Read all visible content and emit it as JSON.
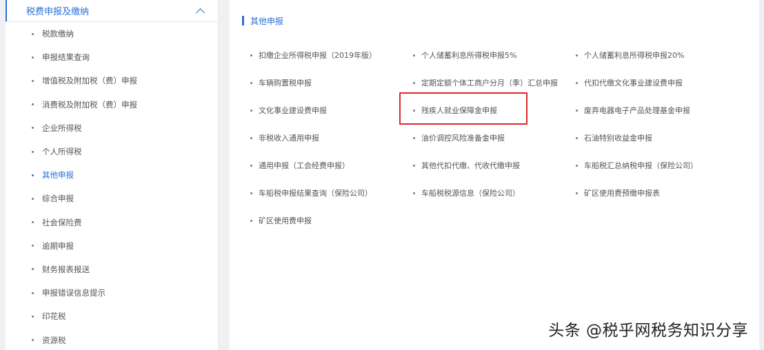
{
  "sidebar": {
    "header_label": "税费申报及缴纳",
    "items": [
      {
        "label": "税款缴纳"
      },
      {
        "label": "申报结果查询"
      },
      {
        "label": "增值税及附加税（费）申报"
      },
      {
        "label": "消费税及附加税（费）申报"
      },
      {
        "label": "企业所得税"
      },
      {
        "label": "个人所得税"
      },
      {
        "label": "其他申报"
      },
      {
        "label": "综合申报"
      },
      {
        "label": "社会保险费"
      },
      {
        "label": "逾期申报"
      },
      {
        "label": "财务报表报送"
      },
      {
        "label": "申报错误信息提示"
      },
      {
        "label": "印花税"
      },
      {
        "label": "资源税"
      }
    ],
    "active_index": 6
  },
  "main": {
    "section_title": "其他申报",
    "items": [
      {
        "label": "扣缴企业所得税申报（2019年版）"
      },
      {
        "label": "个人储蓄利息所得税申报5%"
      },
      {
        "label": "个人储蓄利息所得税申报20%"
      },
      {
        "label": "车辆购置税申报"
      },
      {
        "label": "定期定额个体工商户分月（季）汇总申报"
      },
      {
        "label": "代扣代缴文化事业建设费申报"
      },
      {
        "label": "文化事业建设费申报"
      },
      {
        "label": "残疾人就业保障金申报"
      },
      {
        "label": "废弃电器电子产品处理基金申报"
      },
      {
        "label": "非税收入通用申报"
      },
      {
        "label": "油价调控风险准备金申报"
      },
      {
        "label": "石油特别收益金申报"
      },
      {
        "label": "通用申报（工会经费申报）"
      },
      {
        "label": "其他代扣代缴、代收代缴申报"
      },
      {
        "label": "车船税汇总纳税申报（保险公司）"
      },
      {
        "label": "车船税申报结果查询（保险公司）"
      },
      {
        "label": "车船税税源信息（保险公司）"
      },
      {
        "label": "矿区使用费预缴申报表"
      },
      {
        "label": "矿区使用费申报"
      }
    ],
    "highlighted_index": 7
  },
  "watermark": "头条 @税乎网税务知识分享",
  "colors": {
    "accent": "#2b6fd6",
    "highlight_border": "#d9262c",
    "background": "#eef0f4"
  },
  "icons": {
    "header_chevron": "chevron-up-icon"
  }
}
